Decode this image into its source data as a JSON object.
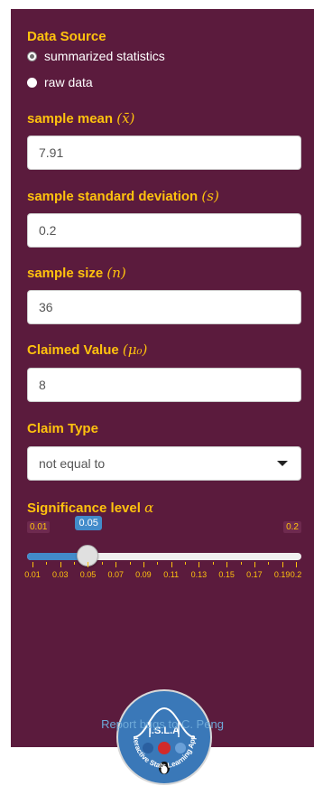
{
  "data_source": {
    "label": "Data Source",
    "options": [
      {
        "label": "summarized statistics",
        "selected": true
      },
      {
        "label": "raw data",
        "selected": false
      }
    ]
  },
  "mean": {
    "label": "sample mean ",
    "symbol": "(x̄)",
    "value": "7.91"
  },
  "sd": {
    "label": "sample standard deviation ",
    "symbol": "(s)",
    "value": "0.2"
  },
  "size": {
    "label": "sample size ",
    "symbol": "(n)",
    "value": "36"
  },
  "claimed": {
    "label": "Claimed Value ",
    "symbol": "(μ₀)",
    "value": "8"
  },
  "claim_type": {
    "label": "Claim Type",
    "value": "not equal to"
  },
  "significance": {
    "label": "Significance level ",
    "symbol": "α",
    "min_label": "0.01",
    "max_label": "0.2",
    "min": 0.01,
    "max": 0.2,
    "value": 0.05,
    "value_label": "0.05",
    "tick_labels": [
      "0.01",
      "0.03",
      "0.05",
      "0.07",
      "0.09",
      "0.11",
      "0.13",
      "0.15",
      "0.17",
      "0.19",
      "0.2"
    ]
  },
  "logo": {
    "acronym": "I.S.L.A",
    "ring_text": "Interactive Stats Learning Apps"
  },
  "footer": {
    "report_text": "Report bugs to C. Peng"
  },
  "colors": {
    "panel": "#5b1b3d",
    "label": "#ffc20e",
    "slider": "#428bca"
  }
}
